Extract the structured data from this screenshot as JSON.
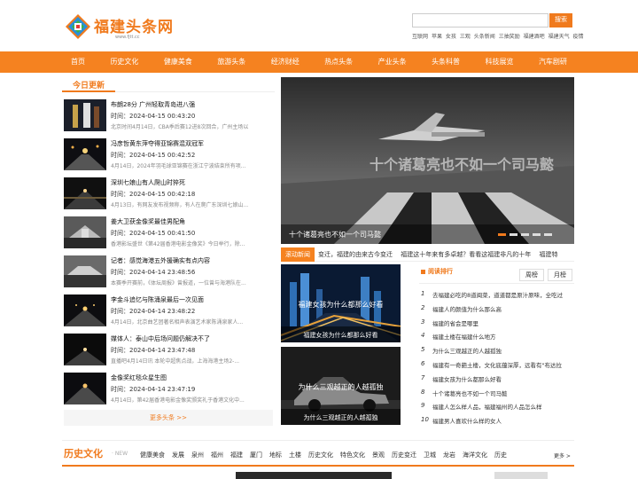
{
  "header": {
    "logo_text": "福建头条网",
    "logo_sub": "www.fjtt.cc",
    "search_button": "搜索",
    "search_placeholder": "",
    "hotlinks": [
      "互联网",
      "苹果",
      "女孩",
      "三观",
      "头条新闻",
      "三抽奖励",
      "福建酒吧",
      "福建天气",
      "疫情"
    ]
  },
  "nav": [
    "首页",
    "历史文化",
    "健康美食",
    "旅游头条",
    "经济财经",
    "热点头条",
    "产业头条",
    "头条科普",
    "科技展览",
    "汽车剧研"
  ],
  "today": {
    "title": "今日更新",
    "items": [
      {
        "title": "布朗28分 广州轻取青岛进八强",
        "time": "时间：2024-04-15 00:43:20",
        "desc": "北京时间4月14日，CBA季后赛12进8次回合，广州主场以"
      },
      {
        "title": "冯彦哲黄东萍夺得亚锦赛混双冠军",
        "time": "时间：2024-04-15 00:42:52",
        "desc": "4月14日，2024年羽毛球亚锦赛在浙江宁波结束所有项..."
      },
      {
        "title": "深圳七娘山有人爬山时猝死",
        "time": "时间：2024-04-15 00:42:18",
        "desc": "4月13日，有网友发布视频称，有人在爬广东深圳七娘山..."
      },
      {
        "title": "姜大卫获金像奖最佳男配角",
        "time": "时间：2024-04-15 00:41:50",
        "desc": "香港影坛盛世《第42届香港电影金像奖》今日举行，除..."
      },
      {
        "title": "记者：感觉海港五外援确实有点内容",
        "time": "时间：2024-04-14 23:48:56",
        "desc": "本赛季开赛前，《体坛周报》曾报道，一位曾与海港队在..."
      },
      {
        "title": "李金斗追忆与陈涌泉最后一次见面",
        "time": "时间：2024-04-14 23:48:22",
        "desc": "4月14日，北京曲艺团著名相声表演艺术家陈涌泉家人..."
      },
      {
        "title": "媒体人：泰山中后场问题仍解决不了",
        "time": "时间：2024-04-14 23:47:48",
        "desc": "直播吧4月14日讯 本轮中超焦点战，上海海港主场2-..."
      },
      {
        "title": "金像奖红毯众星生图",
        "time": "时间：2024-04-14 23:47:19",
        "desc": "4月14日，第42届香港电影金像奖颁奖礼于香港文化中..."
      }
    ],
    "more": "更多头条 >>"
  },
  "slider": {
    "caption": "十个诸葛亮也不如一个司马懿",
    "overlay_text": "十个诸葛亮也不如一个司马懿",
    "dots": 5,
    "active_dot": 0
  },
  "ticker": {
    "label": "滚动新闻",
    "text": "变迁，福建的由来古今变迁　 福建这十年来有多卓越？看看这福建非凡的十年　 福建特"
  },
  "cards": [
    {
      "overlay": "福建女孩为什么都那么好看",
      "caption": "福建女孩为什么都那么好看"
    },
    {
      "overlay": "为什么三观越正的人越孤独",
      "caption": "为什么三观越正的人越孤独"
    }
  ],
  "ranking": {
    "title": "阅读排行",
    "tab_week": "周榜",
    "tab_month": "月榜",
    "items": [
      "去福建必吃的8道闽菜，道道都是原汁原味，全吃过",
      "福建人的颜值为什么那么高",
      "福建的省会是哪里",
      "福建土楼在福建什么地方",
      "为什么三观越正的人越孤独",
      "福建有一奇葩土楼，文化底蕴深厚，远看有\"布达拉",
      "福建女孩为什么都那么好看",
      "十个诸葛亮也不如一个司马懿",
      "福建人怎么样人品，福建福州的人品怎么样",
      "福建男人喜欢什么样的女人"
    ]
  },
  "history": {
    "title": "历史文化",
    "new_label": "· NEW",
    "tags": [
      "健康美食",
      "发展",
      "泉州",
      "福州",
      "福建",
      "厦门",
      "地标",
      "土楼",
      "历史文化",
      "特色文化",
      "景观",
      "历史变迁",
      "卫城",
      "龙岩",
      "海洋文化",
      "历史"
    ],
    "more": "更多 >"
  },
  "colors": {
    "accent": "#f58220"
  }
}
